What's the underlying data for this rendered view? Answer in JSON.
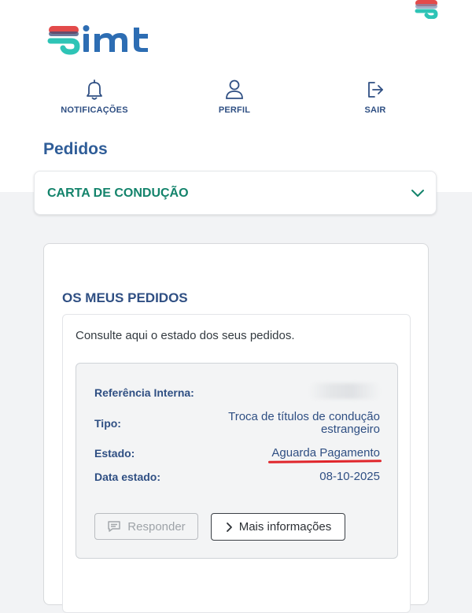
{
  "nav": {
    "notifications_label": "NOTIFICAÇÕES",
    "profile_label": "PERFIL",
    "logout_label": "SAIR"
  },
  "page": {
    "title": "Pedidos"
  },
  "service_select": {
    "selected": "CARTA DE CONDUÇÃO"
  },
  "requests": {
    "section_title": "OS MEUS PEDIDOS",
    "intro": "Consulte aqui o estado dos seus pedidos.",
    "item": {
      "ref_label": "Referência Interna:",
      "type_label": "Tipo:",
      "type_value_line1": "Troca de títulos de condução",
      "type_value_line2": "estrangeiro",
      "status_label": "Estado:",
      "status_value": "Aguarda Pagamento",
      "date_label": "Data estado:",
      "date_value": "08-10-2025",
      "reply_button": "Responder",
      "more_info_button": "Mais informações"
    }
  },
  "colors": {
    "brand_blue": "#2f4f83",
    "brand_green": "#13836b",
    "highlight_red": "#e0252b"
  }
}
